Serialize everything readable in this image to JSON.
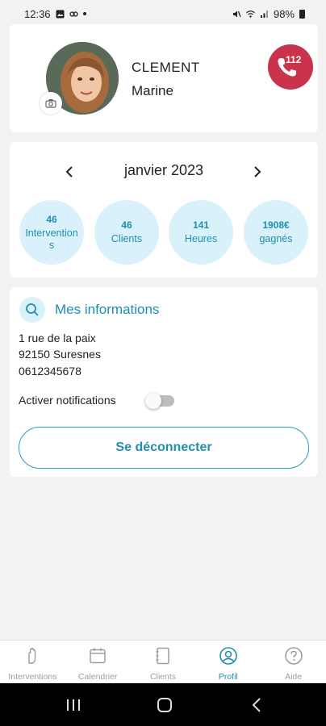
{
  "status_bar": {
    "time": "12:36",
    "battery": "98%"
  },
  "profile": {
    "last_name": "CLEMENT",
    "first_name": "Marine",
    "emergency_number": "112"
  },
  "stats": {
    "month": "janvier 2023",
    "items": [
      {
        "value": "46",
        "label": "Interventions"
      },
      {
        "value": "46",
        "label": "Clients"
      },
      {
        "value": "141",
        "label": "Heures"
      },
      {
        "value": "1908€",
        "label": "gagnés"
      }
    ]
  },
  "info": {
    "title": "Mes informations",
    "address_line1": "1 rue de la paix",
    "address_line2": "92150 Suresnes",
    "phone": "0612345678",
    "notifications_label": "Activer notifications",
    "notifications_enabled": false,
    "logout_label": "Se déconnecter"
  },
  "tabs": [
    {
      "label": "Interventions",
      "icon": "hand-icon",
      "active": false
    },
    {
      "label": "Calendrier",
      "icon": "calendar-icon",
      "active": false
    },
    {
      "label": "Clients",
      "icon": "clients-book-icon",
      "active": false
    },
    {
      "label": "Profil",
      "icon": "profile-icon",
      "active": true
    },
    {
      "label": "Aide",
      "icon": "help-icon",
      "active": false
    }
  ],
  "colors": {
    "accent": "#1f8fae",
    "bubble_bg": "#d9f1fb",
    "emergency_red": "#c9334b"
  }
}
